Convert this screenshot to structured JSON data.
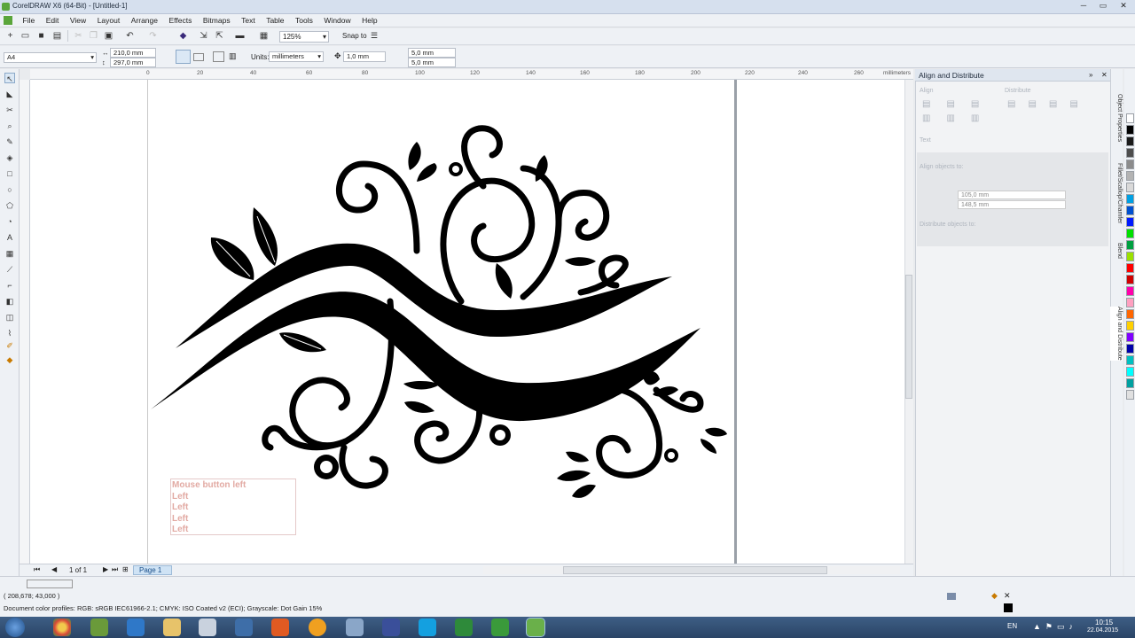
{
  "window": {
    "title": "CorelDRAW X6 (64-Bit) - [Untitled-1]"
  },
  "menu": [
    "File",
    "Edit",
    "View",
    "Layout",
    "Arrange",
    "Effects",
    "Bitmaps",
    "Text",
    "Table",
    "Tools",
    "Window",
    "Help"
  ],
  "toolbar": {
    "zoom": "125%",
    "snap": "Snap to"
  },
  "propbar": {
    "paper": "A4",
    "width": "210,0 mm",
    "height": "297,0 mm",
    "units_label": "Units:",
    "units": "millimeters",
    "nudge": "1,0 mm",
    "dup_x": "5,0 mm",
    "dup_y": "5,0 mm"
  },
  "ruler": {
    "h_ticks": [
      "0",
      "20",
      "40",
      "60",
      "80",
      "100",
      "120",
      "140",
      "160",
      "180",
      "200",
      "220",
      "240",
      "260"
    ],
    "unit": "millimeters"
  },
  "pages": {
    "counter": "1 of 1",
    "tab": "Page 1"
  },
  "hint": {
    "lines": [
      "Mouse button left",
      "Left",
      "Left",
      "Left",
      "Left"
    ]
  },
  "dock": {
    "title": "Align and Distribute",
    "align": "Align",
    "distribute": "Distribute",
    "text": "Text",
    "align_to": "Align objects to:",
    "x": "105,0 mm",
    "y": "148,5 mm",
    "distribute_to": "Distribute objects to:"
  },
  "vtabs": [
    "Object Properties",
    "Fillet/Scallop/Chamfer",
    "Blend",
    "Align and Distribute"
  ],
  "status": {
    "coords": "( 208,678; 43,000 )",
    "profile": "Document color profiles: RGB: sRGB IEC61966-2.1; CMYK: ISO Coated v2 (ECI); Grayscale: Dot Gain 15%"
  },
  "tray": {
    "lang": "EN",
    "time": "10:15",
    "date": "22.04.2015"
  },
  "palette": [
    "#ffffff",
    "#000000",
    "#1a1a1a",
    "#4d4d4d",
    "#8c8c8c",
    "#b3b3b3",
    "#d9d9d9",
    "#00a0e3",
    "#0050d0",
    "#001aff",
    "#00e000",
    "#00a040",
    "#9be000",
    "#ff0000",
    "#d00000",
    "#ff00aa",
    "#ffa0c0",
    "#ff6600",
    "#ffd000",
    "#8000ff",
    "#0000aa",
    "#00c0c0",
    "#00ffff",
    "#00a0a0",
    "#e0e0e0"
  ]
}
